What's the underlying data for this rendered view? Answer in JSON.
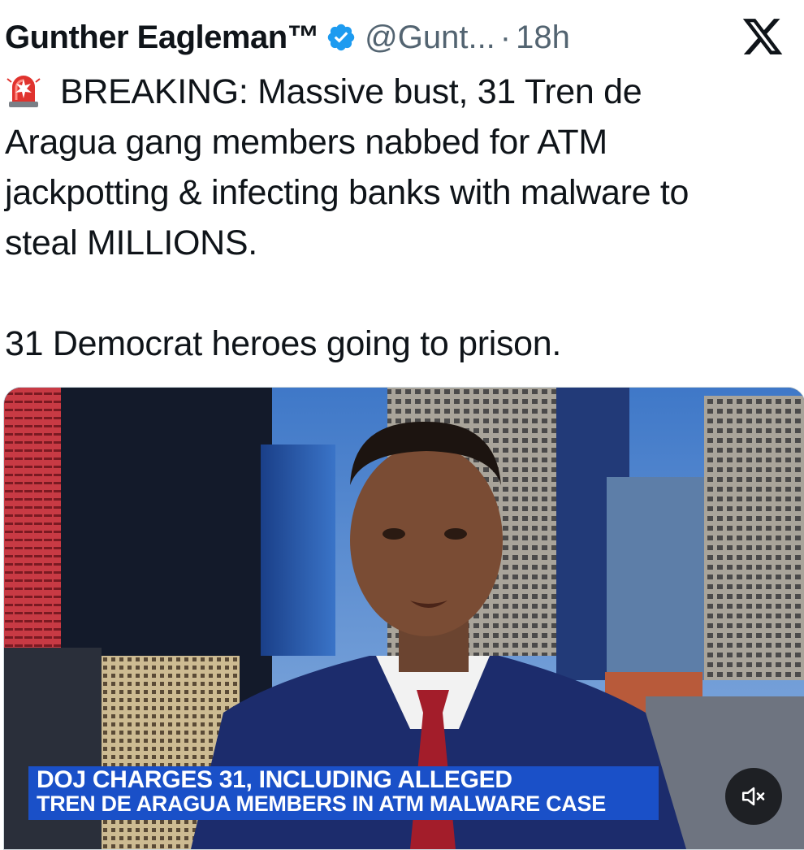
{
  "post": {
    "author_name": "Gunther Eagleman™",
    "handle": "@Gunt...",
    "separator": "·",
    "time_ago": "18h",
    "verified_color": "#1d9bf0",
    "icons": {
      "verified": "verified-badge-icon",
      "platform": "x-logo-icon",
      "siren": "rotating-light-emoji"
    },
    "text": {
      "line1": "BREAKING: Massive bust, 31 Tren de",
      "line2": "Aragua gang members nabbed for ATM",
      "line3": "jackpotting & infecting banks with malware to",
      "line4": "steal MILLIONS.",
      "line5": "31 Democrat heroes going to prison."
    }
  },
  "media": {
    "type": "video",
    "chyron_line1": "DOJ CHARGES 31, INCLUDING ALLEGED",
    "chyron_line2": "TREN DE ARAGUA MEMBERS IN ATM MALWARE CASE",
    "chyron_color": "#1a50c8",
    "mute_icon": "volume-muted-icon"
  }
}
